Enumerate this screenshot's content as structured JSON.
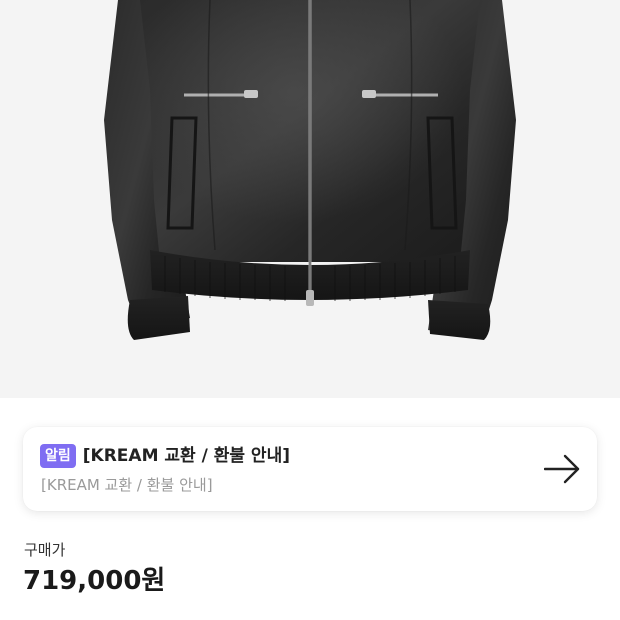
{
  "product_image": {
    "alt": "black leather jacket"
  },
  "notice": {
    "badge": "알림",
    "title": "[KREAM 교환 / 환불 안내]",
    "subtitle": "[KREAM 교환 / 환불 안내]",
    "arrow_icon": "arrow-right-icon",
    "badge_color": "#7f6df2"
  },
  "price": {
    "label": "구매가",
    "value": "719,000원"
  }
}
